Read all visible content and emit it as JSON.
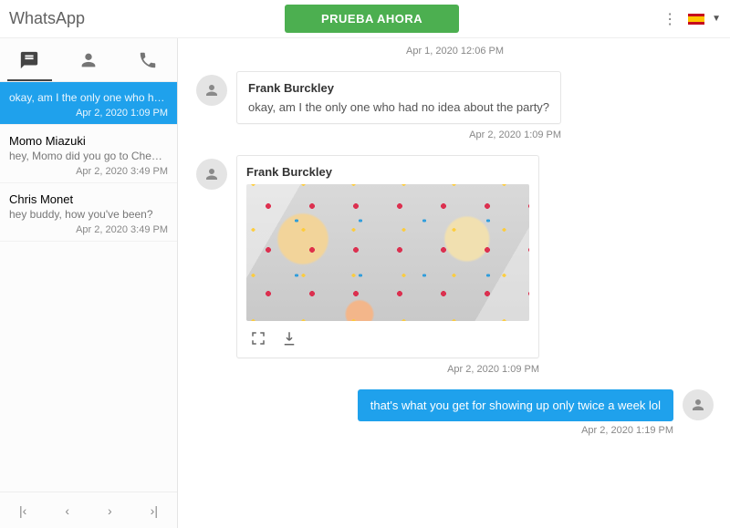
{
  "header": {
    "title": "WhatsApp",
    "cta": "PRUEBA AHORA",
    "locale": "es"
  },
  "sidebar": {
    "tabs": [
      "chats",
      "contacts",
      "calls"
    ],
    "activeTab": 0,
    "chats": [
      {
        "name": "",
        "preview": "okay, am I the only one who had no i...",
        "time": "Apr 2, 2020 1:09 PM",
        "active": true
      },
      {
        "name": "Momo Miazuki",
        "preview": "hey, Momo did you go to Chemistry ...",
        "time": "Apr 2, 2020 3:49 PM",
        "active": false
      },
      {
        "name": "Chris Monet",
        "preview": "hey buddy, how you've been?",
        "time": "Apr 2, 2020 3:49 PM",
        "active": false
      }
    ]
  },
  "conversation": {
    "prev_time": "Apr 1, 2020 12:06 PM",
    "messages": [
      {
        "sender": "Frank Burckley",
        "text": "okay, am I the only one who had no idea about the party?",
        "time": "Apr 2, 2020 1:09 PM"
      },
      {
        "sender": "Frank Burckley",
        "image": true,
        "time": "Apr 2, 2020 1:09 PM"
      }
    ],
    "outgoing": {
      "text": "that's what you get for showing up only twice a week lol",
      "time": "Apr 2, 2020 1:19 PM"
    }
  }
}
